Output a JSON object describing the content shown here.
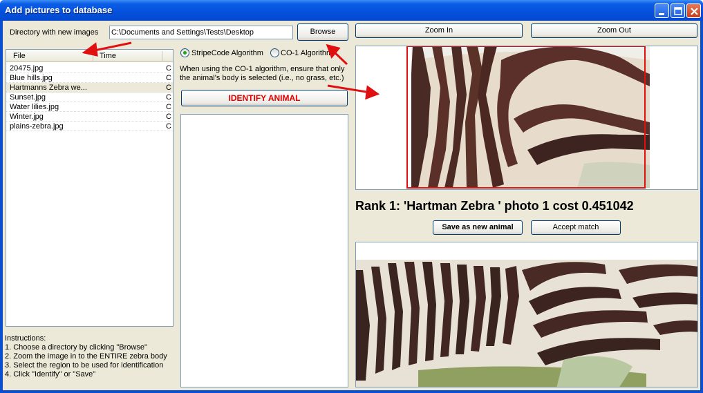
{
  "window": {
    "title": "Add pictures to database"
  },
  "directory": {
    "label": "Directory with new images",
    "value": "C:\\Documents and Settings\\Tests\\Desktop",
    "browse_label": "Browse"
  },
  "file_list": {
    "columns": [
      "File",
      "Time"
    ],
    "rows": [
      {
        "file": "20475.jpg",
        "time": "C"
      },
      {
        "file": "Blue hills.jpg",
        "time": "C"
      },
      {
        "file": "Hartmanns Zebra we...",
        "time": "C"
      },
      {
        "file": "Sunset.jpg",
        "time": "C"
      },
      {
        "file": "Water lilies.jpg",
        "time": "C"
      },
      {
        "file": "Winter.jpg",
        "time": "C"
      },
      {
        "file": "plains-zebra.jpg",
        "time": "C"
      }
    ],
    "selected_index": 2
  },
  "algorithm": {
    "option1": "StripeCode Algorithm",
    "option2": "CO-1 Algorithm",
    "selected": "StripeCode Algorithm",
    "note_line1": "When using the CO-1 algorithm, ensure that only",
    "note_line2": "the animal's body is selected (i.e., no grass, etc.)"
  },
  "identify_label": "IDENTIFY ANIMAL",
  "zoom": {
    "in_label": "Zoom In",
    "out_label": "Zoom Out"
  },
  "result": {
    "rank_text": "Rank 1: 'Hartman Zebra ' photo 1 cost 0.451042",
    "save_label": "Save as new animal",
    "accept_label": "Accept match"
  },
  "instructions": [
    "Instructions:",
    "1. Choose a directory by clicking \"Browse\"",
    "2. Zoom the image in to the ENTIRE zebra body",
    "3. Select the region to be used for identification",
    "4. Click \"Identify\" or \"Save\""
  ],
  "colors": {
    "titlebar": "#0450dc",
    "identify_text": "#e00000",
    "annotation_arrow": "#e01010",
    "selection_rect": "#e01010"
  }
}
